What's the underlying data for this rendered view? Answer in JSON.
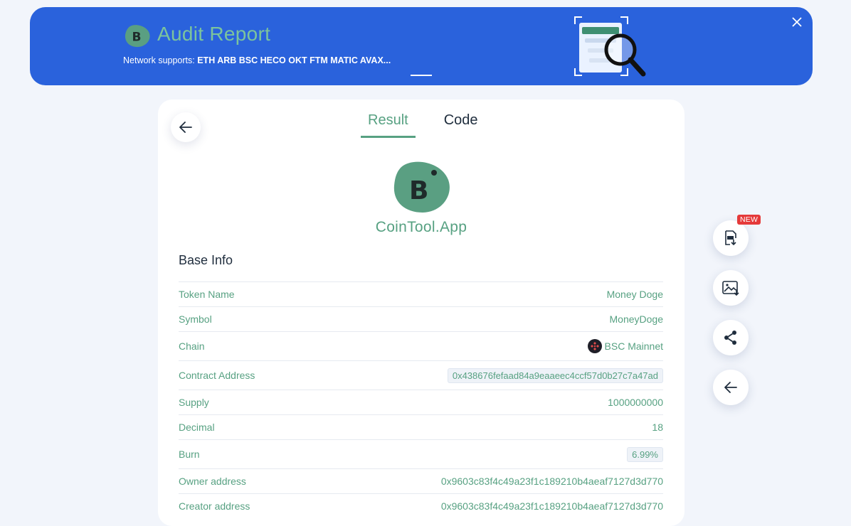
{
  "banner": {
    "title": "Audit Report",
    "network_prefix": "Network supports: ",
    "networks": "ETH ARB BSC HECO OKT FTM MATIC AVAX...",
    "close_icon": "close-icon"
  },
  "tabs": [
    {
      "label": "Result",
      "active": true
    },
    {
      "label": "Code",
      "active": false
    }
  ],
  "brand": {
    "name": "CoinTool.App"
  },
  "base_info": {
    "title": "Base Info",
    "rows": [
      {
        "label": "Token Name",
        "value": "Money Doge"
      },
      {
        "label": "Symbol",
        "value": "MoneyDoge"
      },
      {
        "label": "Chain",
        "value": "BSC Mainnet"
      },
      {
        "label": "Contract Address",
        "value": "0x438676fefaad84a9eaaeec4ccf57d0b27c7a47ad"
      },
      {
        "label": "Supply",
        "value": "1000000000"
      },
      {
        "label": "Decimal",
        "value": "18"
      },
      {
        "label": "Burn",
        "value": "6.99%"
      },
      {
        "label": "Owner address",
        "value": "0x9603c83f4c49a23f1c189210b4aeaf7127d3d770"
      },
      {
        "label": "Creator address",
        "value": "0x9603c83f4c49a23f1c189210b4aeaf7127d3d770"
      }
    ]
  },
  "actions": {
    "new_badge": "NEW",
    "icons": [
      "pdf-download-icon",
      "image-download-icon",
      "share-icon",
      "back-arrow-icon"
    ]
  },
  "colors": {
    "banner_bg": "#2a62dc",
    "accent_green": "#57a182",
    "page_bg": "#f2f5fb",
    "badge_red": "#e53a3a"
  }
}
